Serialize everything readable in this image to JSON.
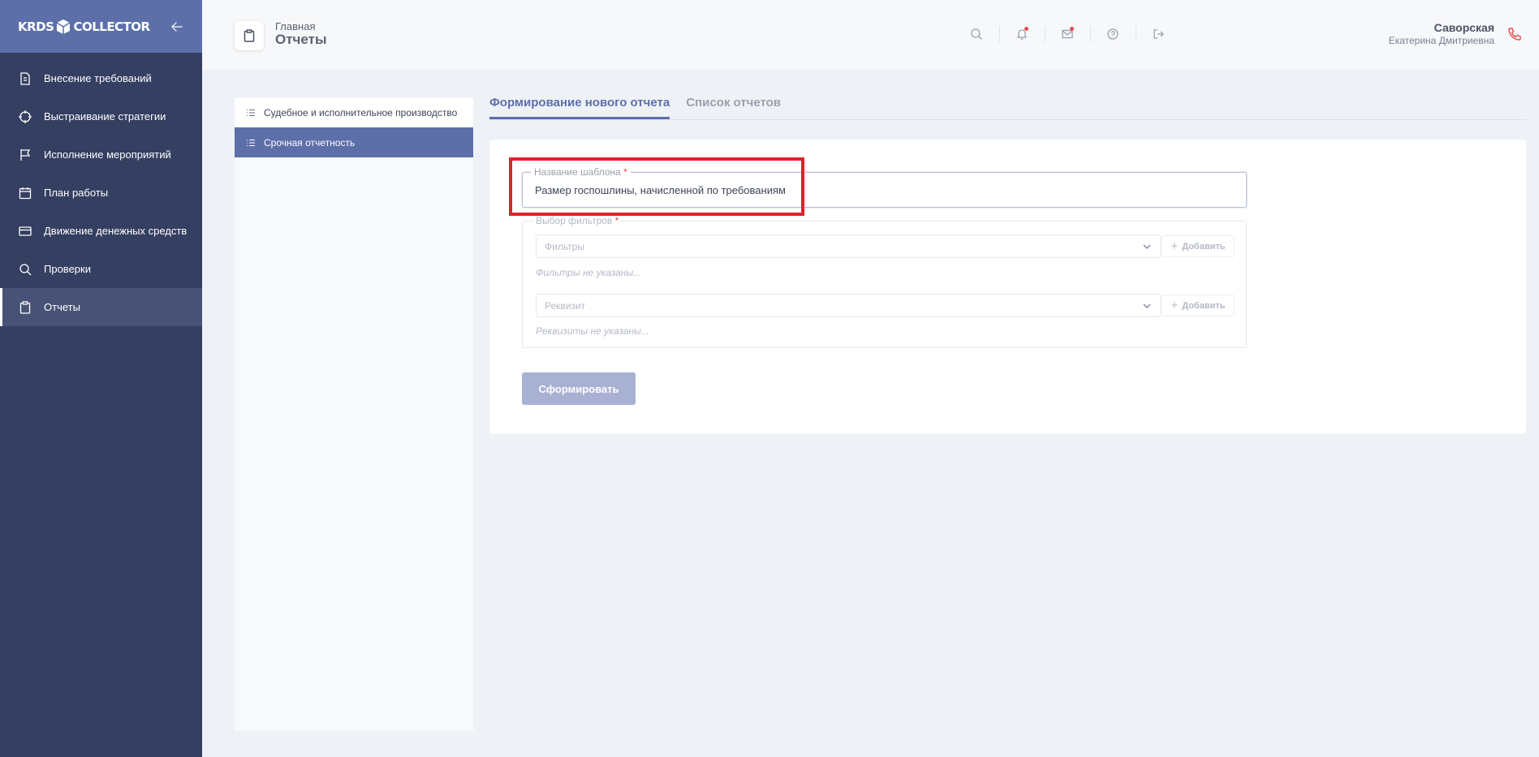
{
  "sidebar": {
    "logo": {
      "left": "KRDS",
      "right": "COLLECTOR"
    },
    "items": [
      {
        "label": "Внесение требований",
        "icon": "document-icon"
      },
      {
        "label": "Выстраивание стратегии",
        "icon": "crosshair-icon"
      },
      {
        "label": "Исполнение мероприятий",
        "icon": "flag-icon"
      },
      {
        "label": "План работы",
        "icon": "calendar-icon"
      },
      {
        "label": "Движение денежных средств",
        "icon": "card-icon"
      },
      {
        "label": "Проверки",
        "icon": "search-icon"
      },
      {
        "label": "Отчеты",
        "icon": "clipboard-icon",
        "active": true
      }
    ]
  },
  "header": {
    "breadcrumb": "Главная",
    "title": "Отчеты",
    "user": {
      "surname": "Саворская",
      "name": "Екатерина Дмитриевна"
    }
  },
  "reports_list": {
    "items": [
      {
        "label": "Судебное и исполнительное производство",
        "active": false
      },
      {
        "label": "Срочная отчетность",
        "active": true
      }
    ]
  },
  "tabs": [
    {
      "label": "Формирование нового отчета",
      "active": true
    },
    {
      "label": "Список отчетов",
      "active": false
    }
  ],
  "form": {
    "template_name": {
      "label": "Название шаблона",
      "required_mark": "*",
      "value": "Размер госпошлины, начисленной по требованиям"
    },
    "filters_group": {
      "label": "Выбор фильтров",
      "required_mark": "*",
      "filters_placeholder": "Фильтры",
      "filters_empty": "Фильтры не указаны...",
      "requisite_placeholder": "Реквизит",
      "requisite_empty": "Реквизиты не указаны...",
      "add_label": "Добавить"
    },
    "submit_label": "Сформировать"
  },
  "colors": {
    "sidebar_bg": "#343f61",
    "accent": "#5d6fa9",
    "highlight": "#e3202a"
  }
}
